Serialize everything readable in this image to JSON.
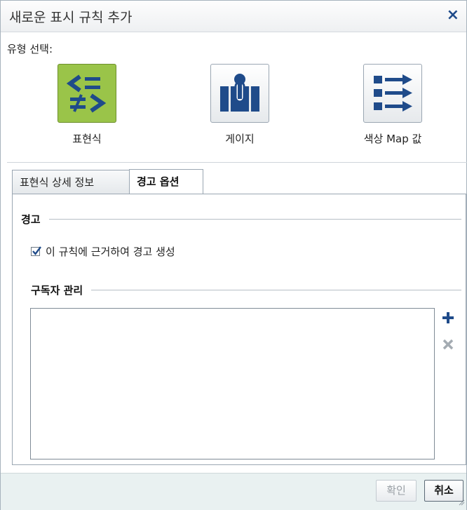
{
  "dialog": {
    "title": "새로운 표시 규칙 추가",
    "close_label": "×"
  },
  "type_select": {
    "label": "유형 선택:",
    "options": [
      {
        "name": "표현식",
        "icon": "expression-icon",
        "selected": true
      },
      {
        "name": "게이지",
        "icon": "gauge-icon",
        "selected": false
      },
      {
        "name": "색상 Map 값",
        "icon": "color-map-icon",
        "selected": false
      }
    ]
  },
  "tabs": [
    {
      "label": "표현식 상세 정보",
      "active": false
    },
    {
      "label": "경고 옵션",
      "active": true
    }
  ],
  "alert": {
    "group_title": "경고",
    "checkbox_label": "이 규칙에 근거하여 경고 생성",
    "checked": true
  },
  "subscribers": {
    "group_title": "구독자 관리",
    "add_icon": "plus-icon",
    "remove_icon": "remove-icon"
  },
  "footer": {
    "ok_label": "확인",
    "cancel_label": "취소"
  },
  "colors": {
    "icon_blue": "#1f4b8a",
    "selected_green": "#9ac449",
    "footer_bg": "#e9f1f1"
  }
}
